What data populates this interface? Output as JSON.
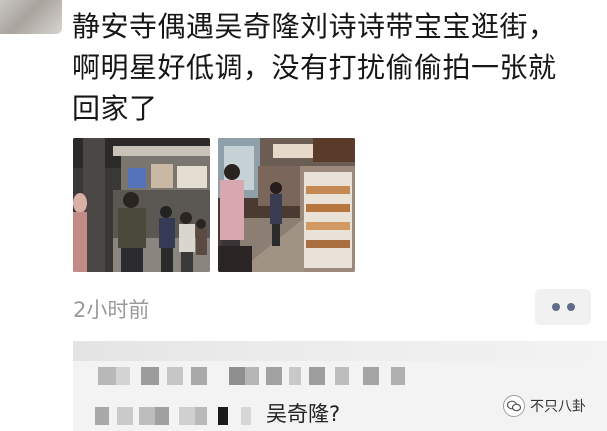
{
  "post": {
    "text_lines": [
      "静安寺偶遇吴奇隆刘诗诗带宝宝逛街，",
      "啊明星好低调，没有打扰偷偷拍一张就",
      "回家了"
    ],
    "timestamp": "2小时前"
  },
  "comment": {
    "visible_tail": "吴奇隆?"
  },
  "watermark": {
    "text": "不只八卦"
  },
  "icons": {
    "more": "more-dots-icon",
    "watermark": "wechat-account-icon"
  },
  "colors": {
    "timestamp": "#9a9a9a",
    "more_dots": "#5f6b88",
    "comment_bg": "#f3f3f3"
  }
}
